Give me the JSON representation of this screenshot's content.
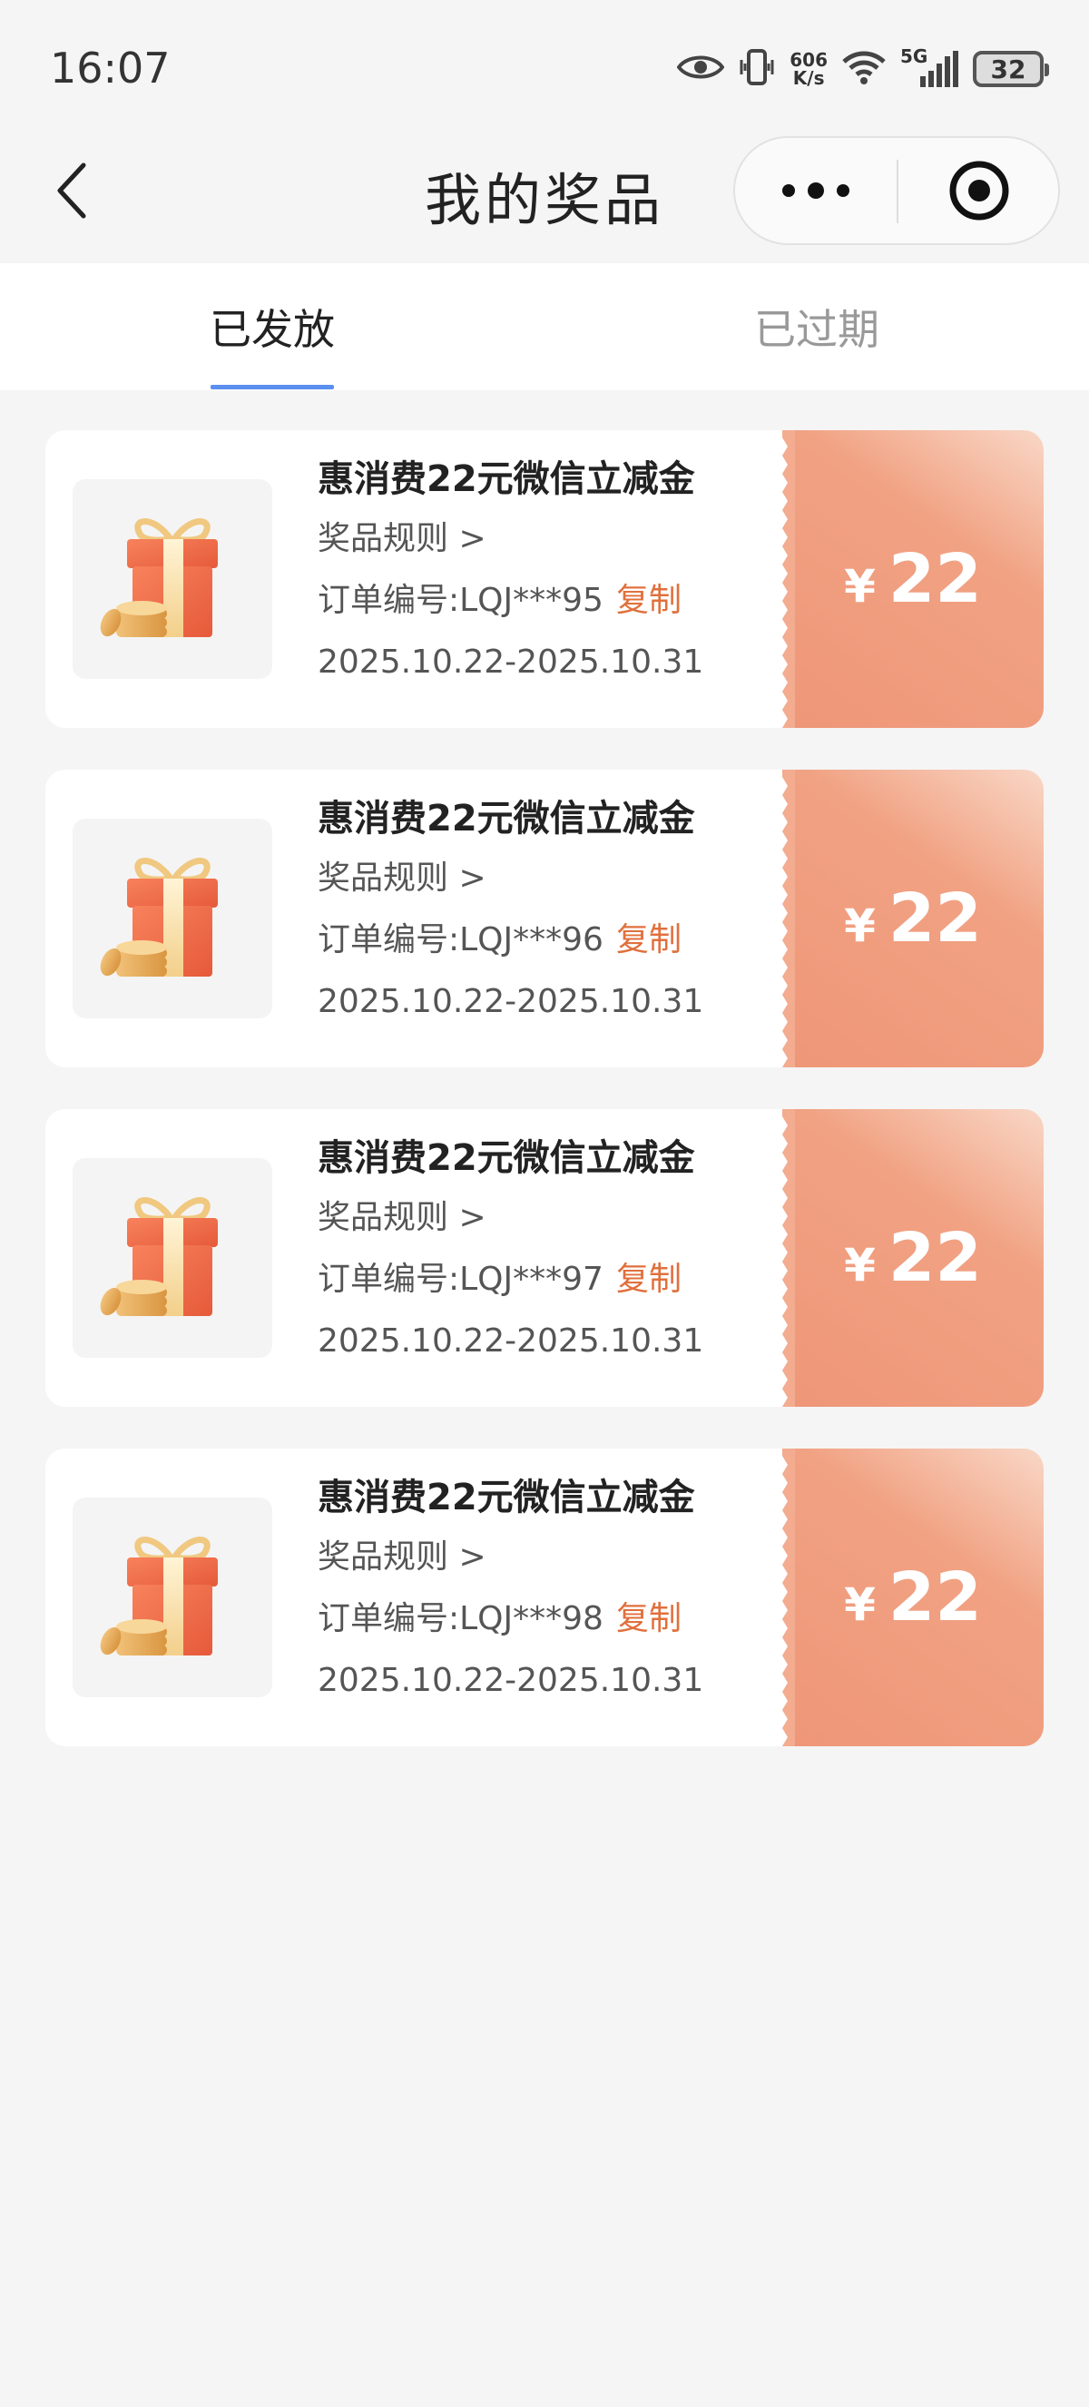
{
  "status_bar": {
    "time": "16:07",
    "net_speed_value": "606",
    "net_speed_unit": "K/s",
    "network_type": "5G",
    "battery": "32"
  },
  "nav": {
    "title": "我的奖品"
  },
  "tabs": [
    {
      "label": "已发放",
      "active": true
    },
    {
      "label": "已过期",
      "active": false
    }
  ],
  "colors": {
    "accent_tab": "#5b8ff0",
    "copy_link": "#e0703d",
    "voucher_start": "#f9d7c6",
    "voucher_end": "#ef9678"
  },
  "prizes": [
    {
      "title": "惠消费22元微信立减金",
      "rules": "奖品规则 >",
      "order": "订单编号:LQJ***95",
      "copy": "复制",
      "validity": "2025.10.22-2025.10.31",
      "currency": "¥",
      "amount": "22",
      "icon": "gift-box-with-coins-icon"
    },
    {
      "title": "惠消费22元微信立减金",
      "rules": "奖品规则 >",
      "order": "订单编号:LQJ***96",
      "copy": "复制",
      "validity": "2025.10.22-2025.10.31",
      "currency": "¥",
      "amount": "22",
      "icon": "gift-box-with-coins-icon"
    },
    {
      "title": "惠消费22元微信立减金",
      "rules": "奖品规则 >",
      "order": "订单编号:LQJ***97",
      "copy": "复制",
      "validity": "2025.10.22-2025.10.31",
      "currency": "¥",
      "amount": "22",
      "icon": "gift-box-with-coins-icon"
    },
    {
      "title": "惠消费22元微信立减金",
      "rules": "奖品规则 >",
      "order": "订单编号:LQJ***98",
      "copy": "复制",
      "validity": "2025.10.22-2025.10.31",
      "currency": "¥",
      "amount": "22",
      "icon": "gift-box-with-coins-icon"
    }
  ]
}
